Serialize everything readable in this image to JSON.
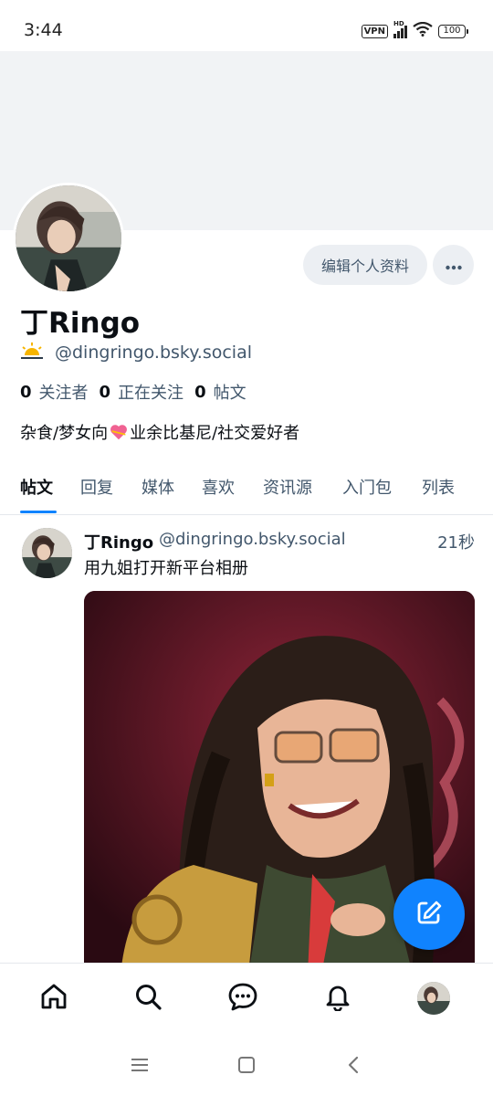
{
  "status_bar": {
    "time": "3:44",
    "vpn": "VPN",
    "signal_label": "HD",
    "battery": "100"
  },
  "profile": {
    "display_name": "丁Ringo",
    "handle": "@dingringo.bsky.social",
    "weather_icon": "sunrise-icon",
    "edit_button": "编辑个人资料",
    "more_button_icon": "ellipsis-icon",
    "stats": [
      {
        "count": "0",
        "label": "关注者"
      },
      {
        "count": "0",
        "label": "正在关注"
      },
      {
        "count": "0",
        "label": "帖文"
      }
    ],
    "bio_before": "杂食/梦女向",
    "bio_after": "业余比基尼/社交爱好者"
  },
  "tabs": [
    "帖文",
    "回复",
    "媒体",
    "喜欢",
    "资讯源",
    "入门包",
    "列表"
  ],
  "active_tab": "帖文",
  "post": {
    "author_name": "丁Ringo",
    "author_handle": "@dingringo.bsky.social",
    "time": "21秒",
    "text": "用九姐打开新平台相册"
  },
  "bottom_nav": [
    "home-icon",
    "search-icon",
    "chat-icon",
    "bell-icon",
    "profile-avatar"
  ],
  "system_nav": [
    "menu-icon",
    "home-square-icon",
    "back-icon"
  ],
  "colors": {
    "accent": "#1083fe",
    "muted_text": "#42576c",
    "banner": "#f1f3f5",
    "button_bg": "#eceff3"
  }
}
